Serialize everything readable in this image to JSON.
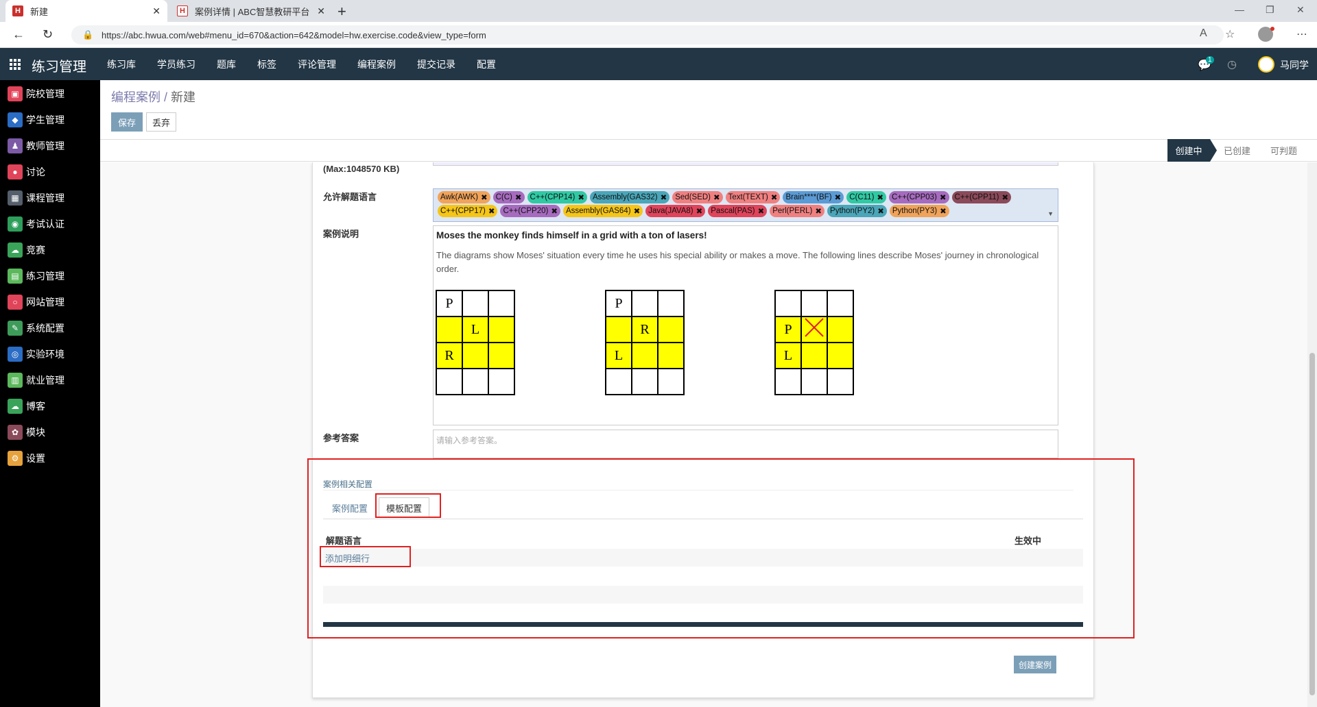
{
  "browser": {
    "tabs": [
      {
        "title": "新建",
        "favicon": "H",
        "active": true
      },
      {
        "title": "案例详情 | ABC智慧教研平台",
        "favicon": "H",
        "active": false
      }
    ],
    "url": "https://abc.hwua.com/web#menu_id=670&action=642&model=hw.exercise.code&view_type=form"
  },
  "appbar": {
    "title": "练习管理",
    "menu": [
      "练习库",
      "学员练习",
      "题库",
      "标签",
      "评论管理",
      "编程案例",
      "提交记录",
      "配置"
    ],
    "chat_badge": "1",
    "user": "马同学"
  },
  "sidebar": {
    "items": [
      {
        "label": "院校管理",
        "color": "#e0445a"
      },
      {
        "label": "学生管理",
        "color": "#2b6cc4"
      },
      {
        "label": "教师管理",
        "color": "#7c5aa6"
      },
      {
        "label": "讨论",
        "color": "#e0445a"
      },
      {
        "label": "课程管理",
        "color": "#555e6b"
      },
      {
        "label": "考试认证",
        "color": "#2e9e5b"
      },
      {
        "label": "竞赛",
        "color": "#3aa35a"
      },
      {
        "label": "练习管理",
        "color": "#5cb85c"
      },
      {
        "label": "网站管理",
        "color": "#e0445a"
      },
      {
        "label": "系统配置",
        "color": "#3d9c5a"
      },
      {
        "label": "实验环境",
        "color": "#2b6cc4"
      },
      {
        "label": "就业管理",
        "color": "#5cb85c"
      },
      {
        "label": "博客",
        "color": "#3aa35a"
      },
      {
        "label": "模块",
        "color": "#8b4a5a"
      },
      {
        "label": "设置",
        "color": "#e6a23c"
      }
    ]
  },
  "control": {
    "breadcrumb_parent": "编程案例",
    "breadcrumb_sep": " / ",
    "breadcrumb_current": "新建",
    "save_label": "保存",
    "discard_label": "丢弃"
  },
  "stages": [
    "创建中",
    "已创建",
    "可判题"
  ],
  "form": {
    "max_label": "(Max:1048570 KB)",
    "languages_label": "允许解题语言",
    "languages": [
      {
        "name": "Awk(AWK)",
        "color": "#f0a35a"
      },
      {
        "name": "C(C)",
        "color": "#a66bbe"
      },
      {
        "name": "C++(CPP14)",
        "color": "#30c9a3"
      },
      {
        "name": "Assembly(GAS32)",
        "color": "#4aa6b8"
      },
      {
        "name": "Sed(SED)",
        "color": "#f08080"
      },
      {
        "name": "Text(TEXT)",
        "color": "#f08080"
      },
      {
        "name": "Brain****(BF)",
        "color": "#5b9bd5"
      },
      {
        "name": "C(C11)",
        "color": "#30c9a3"
      },
      {
        "name": "C++(CPP03)",
        "color": "#a66bbe"
      },
      {
        "name": "C++(CPP11)",
        "color": "#8b4a5a"
      },
      {
        "name": "C++(CPP17)",
        "color": "#f5c518"
      },
      {
        "name": "C++(CPP20)",
        "color": "#a66bbe"
      },
      {
        "name": "Assembly(GAS64)",
        "color": "#f5c518"
      },
      {
        "name": "Java(JAVA8)",
        "color": "#e0445a"
      },
      {
        "name": "Pascal(PAS)",
        "color": "#e0445a"
      },
      {
        "name": "Perl(PERL)",
        "color": "#f08080"
      },
      {
        "name": "Python(PY2)",
        "color": "#4aa6b8"
      },
      {
        "name": "Python(PY3)",
        "color": "#f0a35a"
      }
    ],
    "description_label": "案例说明",
    "description_heading": "Moses the monkey finds himself in a grid with a ton of lasers!",
    "description_text": "The diagrams show Moses' situation every time he uses his special ability or makes a move. The following lines describe Moses' journey in chronological order.",
    "grids": [
      [
        [
          "P",
          "",
          ""
        ],
        [
          "",
          "L",
          ""
        ],
        [
          "R",
          "",
          ""
        ],
        [
          "",
          "",
          ""
        ]
      ],
      [
        [
          "P",
          "",
          ""
        ],
        [
          "",
          "R",
          ""
        ],
        [
          "L",
          "",
          ""
        ],
        [
          "",
          "",
          ""
        ]
      ],
      [
        [
          "",
          "",
          ""
        ],
        [
          "P",
          "X",
          ""
        ],
        [
          "L",
          "",
          ""
        ],
        [
          "",
          "",
          ""
        ]
      ]
    ],
    "answer_label": "参考答案",
    "answer_placeholder": "请输入参考答案。"
  },
  "config": {
    "section_title": "案例相关配置",
    "tabs": [
      "案例配置",
      "模板配置"
    ],
    "col_language": "解题语言",
    "col_active": "生效中",
    "add_line": "添加明细行",
    "create_button": "创建案例"
  }
}
